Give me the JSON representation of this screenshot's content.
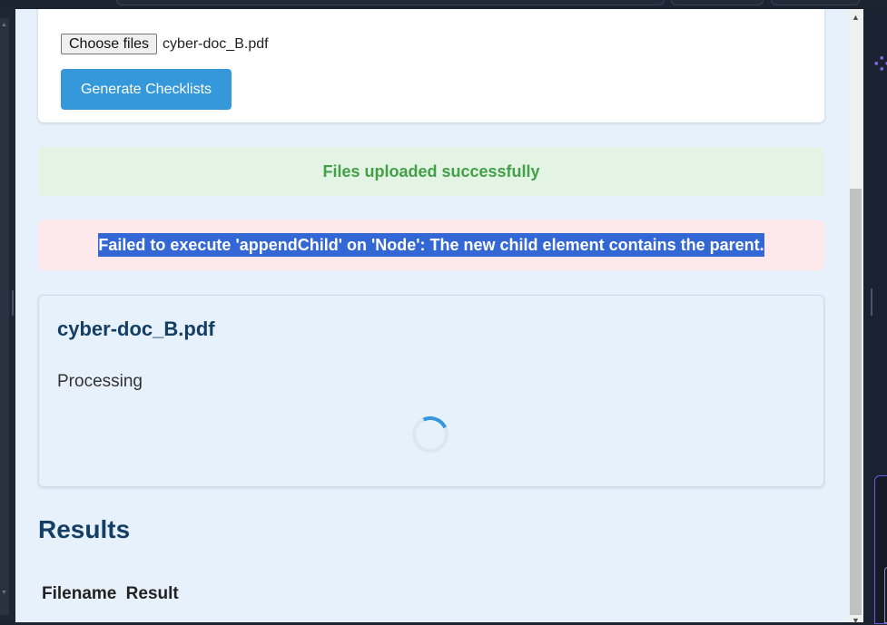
{
  "upload": {
    "choose_label": "Choose files",
    "file_name": "cyber-doc_B.pdf",
    "generate_label": "Generate Checklists"
  },
  "alerts": {
    "success": "Files uploaded successfully",
    "error": "Failed to execute 'appendChild' on 'Node': The new child element contains the parent."
  },
  "document": {
    "title": "cyber-doc_B.pdf",
    "status": "Processing"
  },
  "results": {
    "heading": "Results",
    "columns": [
      "Filename",
      "Result"
    ]
  },
  "colors": {
    "accent": "#3498db",
    "heading": "#143e63",
    "success_text": "#43a047",
    "success_bg": "#e3f4e4",
    "error_bg": "#fde9ec",
    "selection": "#3367d6",
    "page_bg": "#e6f1fc"
  },
  "icons": {
    "spinner": "loading-spinner-icon",
    "scroll_up": "scroll-up-arrow-icon",
    "scroll_down": "scroll-down-arrow-icon",
    "extension": "extension-logo-icon"
  }
}
